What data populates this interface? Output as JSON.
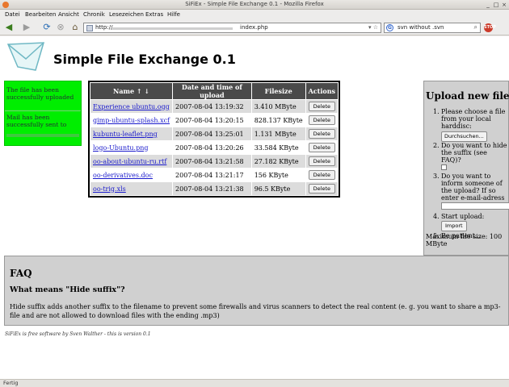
{
  "window": {
    "title": "SiFiEx - Simple File Exchange 0.1 - Mozilla Firefox",
    "minimize": "_",
    "maximize": "□",
    "close": "×"
  },
  "menu": [
    "Datei",
    "Bearbeiten",
    "Ansicht",
    "Chronik",
    "Lesezeichen",
    "Extras",
    "Hilfe"
  ],
  "nav": {
    "url_prefix": "http://",
    "url_suffix": "index.php",
    "search_value": "svn without .svn"
  },
  "page": {
    "title": "Simple File Exchange 0.1",
    "messages": {
      "uploaded": "The file has been successfully uploaded",
      "mail_sent": "Mail has been successfully sent to"
    },
    "table": {
      "headers": [
        "Name ↑ ↓",
        "Date and time of upload",
        "Filesize",
        "Actions"
      ],
      "delete_label": "Delete",
      "rows": [
        {
          "name": "Experience ubuntu.ogg",
          "date": "2007-08-04 13:19:32",
          "size": "3.410 MByte"
        },
        {
          "name": "gimp-ubuntu-splash.xcf",
          "date": "2007-08-04 13:20:15",
          "size": "828.137 KByte"
        },
        {
          "name": "kubuntu-leaflet.png",
          "date": "2007-08-04 13:25:01",
          "size": "1.131 MByte"
        },
        {
          "name": "logo-Ubuntu.png",
          "date": "2007-08-04 13:20:26",
          "size": "33.584 KByte"
        },
        {
          "name": "oo-about-ubuntu-ru.rtf",
          "date": "2007-08-04 13:21:58",
          "size": "27.182 KByte"
        },
        {
          "name": "oo-derivatives.doc",
          "date": "2007-08-04 13:21:17",
          "size": "156 KByte"
        },
        {
          "name": "oo-trig.xls",
          "date": "2007-08-04 13:21:38",
          "size": "96.5 KByte"
        }
      ]
    },
    "upload": {
      "heading": "Upload new file",
      "step1": "Please choose a file from your local harddisc:",
      "browse_label": "Durchsuchen...",
      "step2": "Do you want to hide the suffix (see FAQ)?",
      "step3": "Do you want to inform someone of the upload? If so enter e-mail-adress",
      "step4": "Start upload:",
      "import_label": "Import",
      "step5": "Be patient...",
      "max_size": "Maximum file size: 100 MByte"
    },
    "faq": {
      "heading": "FAQ",
      "question": "What means \"Hide suffix\"?",
      "answer": "Hide suffix adds another suffix to the filename to prevent some firewalls and virus scanners to detect the real content (e. g. you want to share a mp3-file and are not allowed to download files with the ending .mp3)"
    },
    "footer": "SiFiEx is free software by Sven Walther - this is version 0.1"
  },
  "statusbar": {
    "text": "Fertig"
  }
}
